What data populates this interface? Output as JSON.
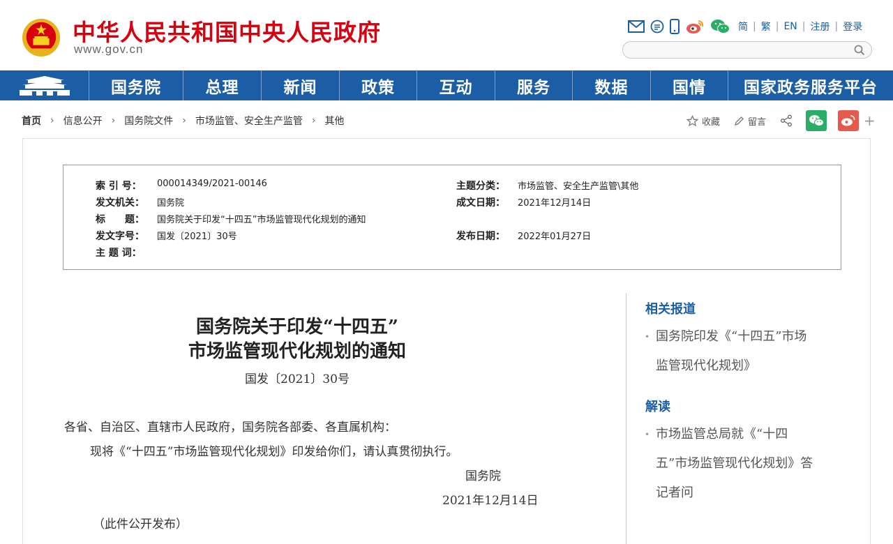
{
  "header": {
    "site_title": "中华人民共和国中央人民政府",
    "site_domain": "www.gov.cn",
    "lang_links": [
      "简",
      "繁",
      "EN",
      "注册",
      "登录"
    ],
    "search_placeholder": ""
  },
  "nav": {
    "items": [
      "国务院",
      "总理",
      "新闻",
      "政策",
      "互动",
      "服务",
      "数据",
      "国情",
      "国家政务服务平台"
    ]
  },
  "breadcrumb": {
    "items": [
      "首页",
      "信息公开",
      "国务院文件",
      "市场监管、安全生产监管",
      "其他"
    ]
  },
  "share": {
    "favorite_label": "收藏",
    "comment_label": "留言",
    "plus": "+"
  },
  "meta": {
    "index_no_label": "索 引 号：",
    "index_no": "000014349/2021-00146",
    "issuer_label": "发文机关：",
    "issuer": "国务院",
    "title_label": "标　　题：",
    "title": "国务院关于印发“十四五”市场监管现代化规划的通知",
    "doc_no_label": "发文字号：",
    "doc_no": "国发〔2021〕30号",
    "keywords_label": "主 题 词：",
    "keywords": "",
    "category_label": "主题分类：",
    "category": "市场监管、安全生产监管\\其他",
    "written_date_label": "成文日期：",
    "written_date": "2021年12月14日",
    "publish_date_label": "发布日期：",
    "publish_date": "2022年01月27日"
  },
  "article": {
    "title_line1": "国务院关于印发“十四五”",
    "title_line2": "市场监管现代化规划的通知",
    "doc_no": "国发〔2021〕30号",
    "salutation": "各省、自治区、直辖市人民政府，国务院各部委、各直属机构：",
    "body": "现将《“十四五”市场监管现代化规划》印发给你们，请认真贯彻执行。",
    "signer": "国务院",
    "date": "2021年12月14日",
    "note": "（此件公开发布）"
  },
  "sidebar": {
    "related_heading": "相关报道",
    "related_line1": "国务院印发《“十四五”市场",
    "related_line2": "监管现代化规划》",
    "interp_heading": "解读",
    "interp_line1": "市场监管总局就《“十四",
    "interp_line2": "五”市场监管现代化规划》答",
    "interp_line3": "记者问"
  },
  "colors": {
    "brand_red": "#d7000f",
    "nav_blue": "#1b5ea5",
    "wechat_green": "#2aae67",
    "weibo_red": "#e6594f"
  }
}
